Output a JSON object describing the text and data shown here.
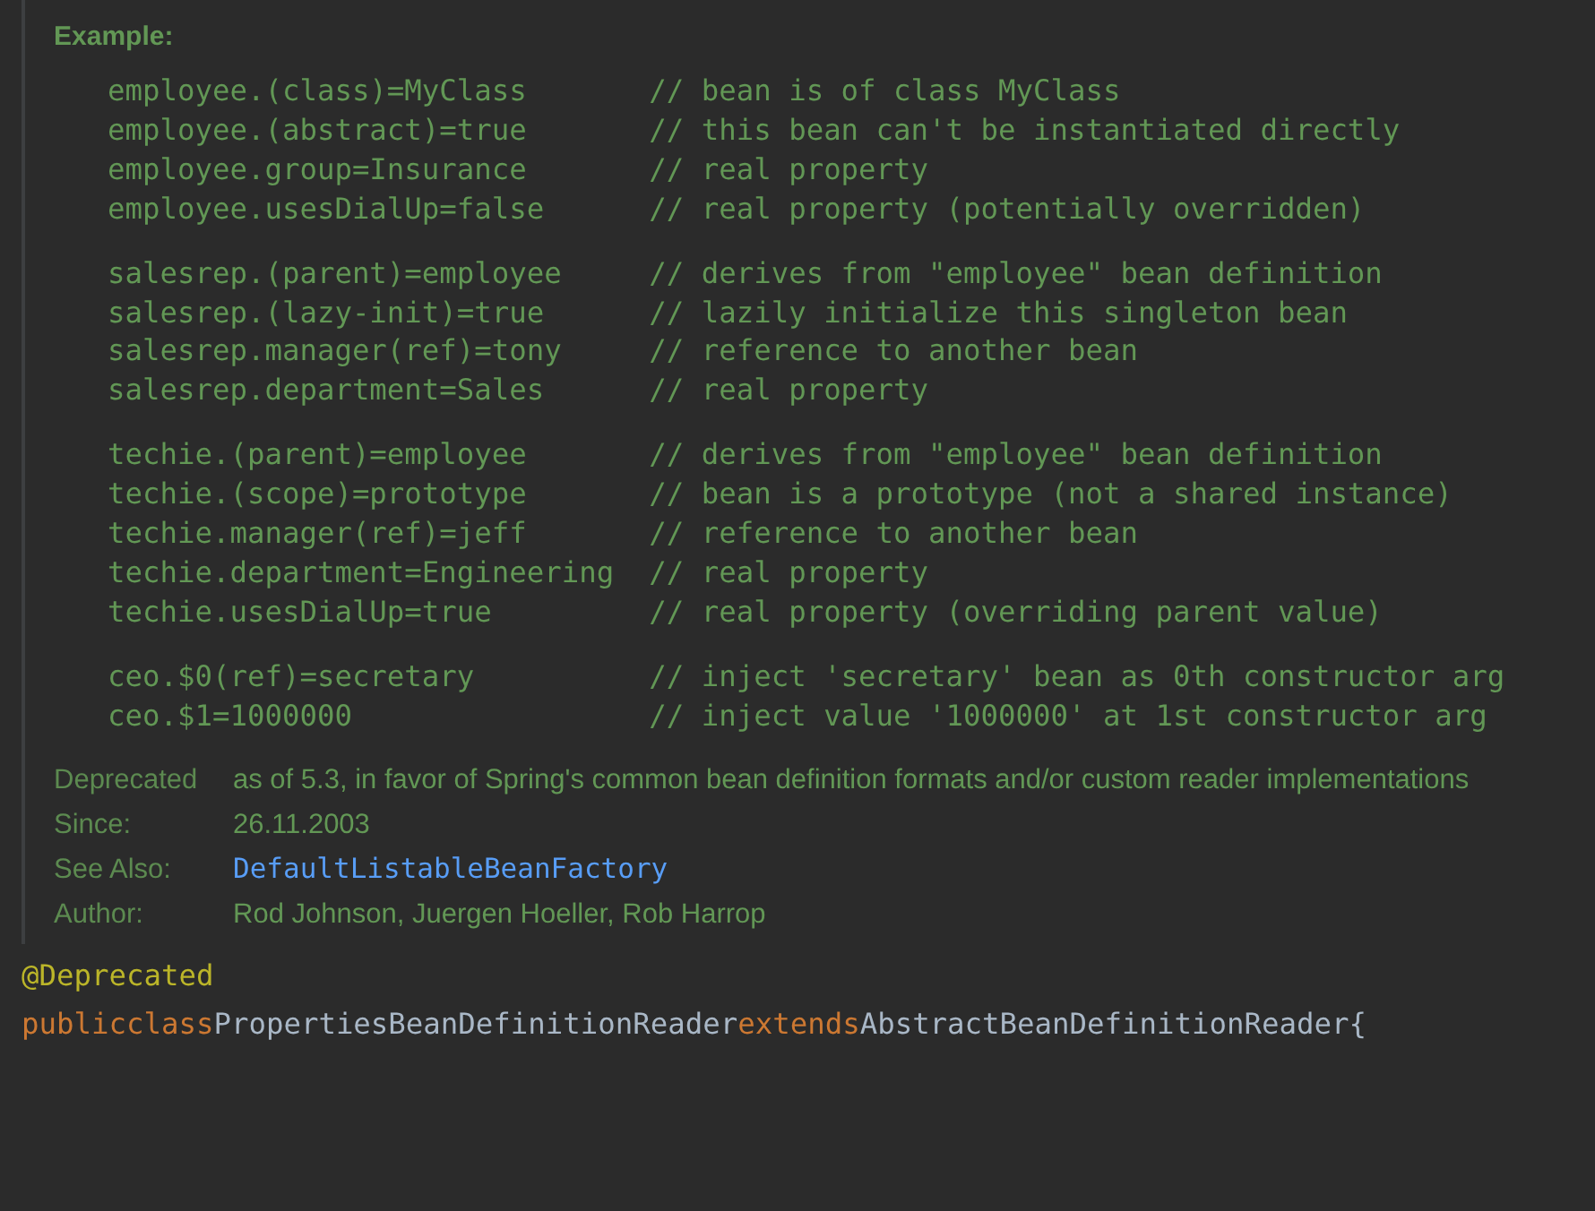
{
  "doc": {
    "example_label": "Example:",
    "example_groups": [
      [
        {
          "code": "employee.(class)=MyClass",
          "comment": "// bean is of class MyClass"
        },
        {
          "code": "employee.(abstract)=true",
          "comment": "// this bean can't be instantiated directly"
        },
        {
          "code": "employee.group=Insurance",
          "comment": "// real property"
        },
        {
          "code": "employee.usesDialUp=false",
          "comment": "// real property (potentially overridden)"
        }
      ],
      [
        {
          "code": "salesrep.(parent)=employee",
          "comment": "// derives from \"employee\" bean definition"
        },
        {
          "code": "salesrep.(lazy-init)=true",
          "comment": "// lazily initialize this singleton bean"
        },
        {
          "code": "salesrep.manager(ref)=tony",
          "comment": "// reference to another bean"
        },
        {
          "code": "salesrep.department=Sales",
          "comment": "// real property"
        }
      ],
      [
        {
          "code": "techie.(parent)=employee",
          "comment": "// derives from \"employee\" bean definition"
        },
        {
          "code": "techie.(scope)=prototype",
          "comment": "// bean is a prototype (not a shared instance)"
        },
        {
          "code": "techie.manager(ref)=jeff",
          "comment": "// reference to another bean"
        },
        {
          "code": "techie.department=Engineering",
          "comment": "// real property"
        },
        {
          "code": "techie.usesDialUp=true",
          "comment": "// real property (overriding parent value)"
        }
      ],
      [
        {
          "code": "ceo.$0(ref)=secretary",
          "comment": "// inject 'secretary' bean as 0th constructor arg"
        },
        {
          "code": "ceo.$1=1000000",
          "comment": "// inject value '1000000' at 1st constructor arg"
        }
      ]
    ],
    "tags": [
      {
        "label": "Deprecated",
        "value": "as of 5.3, in favor of Spring's common bean definition formats and/or custom reader implementations",
        "kind": "text"
      },
      {
        "label": "Since:",
        "value": "26.11.2003",
        "kind": "text"
      },
      {
        "label": "See Also:",
        "value": "DefaultListableBeanFactory",
        "kind": "link"
      },
      {
        "label": "Author:",
        "value": "Rod Johnson, Juergen Hoeller, Rob Harrop",
        "kind": "text"
      }
    ]
  },
  "code": {
    "annotation": "@Deprecated",
    "declaration": [
      {
        "text": "public",
        "kind": "keyword"
      },
      {
        "text": "class",
        "kind": "keyword"
      },
      {
        "text": "PropertiesBeanDefinitionReader",
        "kind": "name"
      },
      {
        "text": "extends",
        "kind": "keyword"
      },
      {
        "text": "AbstractBeanDefinitionReader",
        "kind": "name"
      },
      {
        "text": "{",
        "kind": "name"
      }
    ]
  }
}
